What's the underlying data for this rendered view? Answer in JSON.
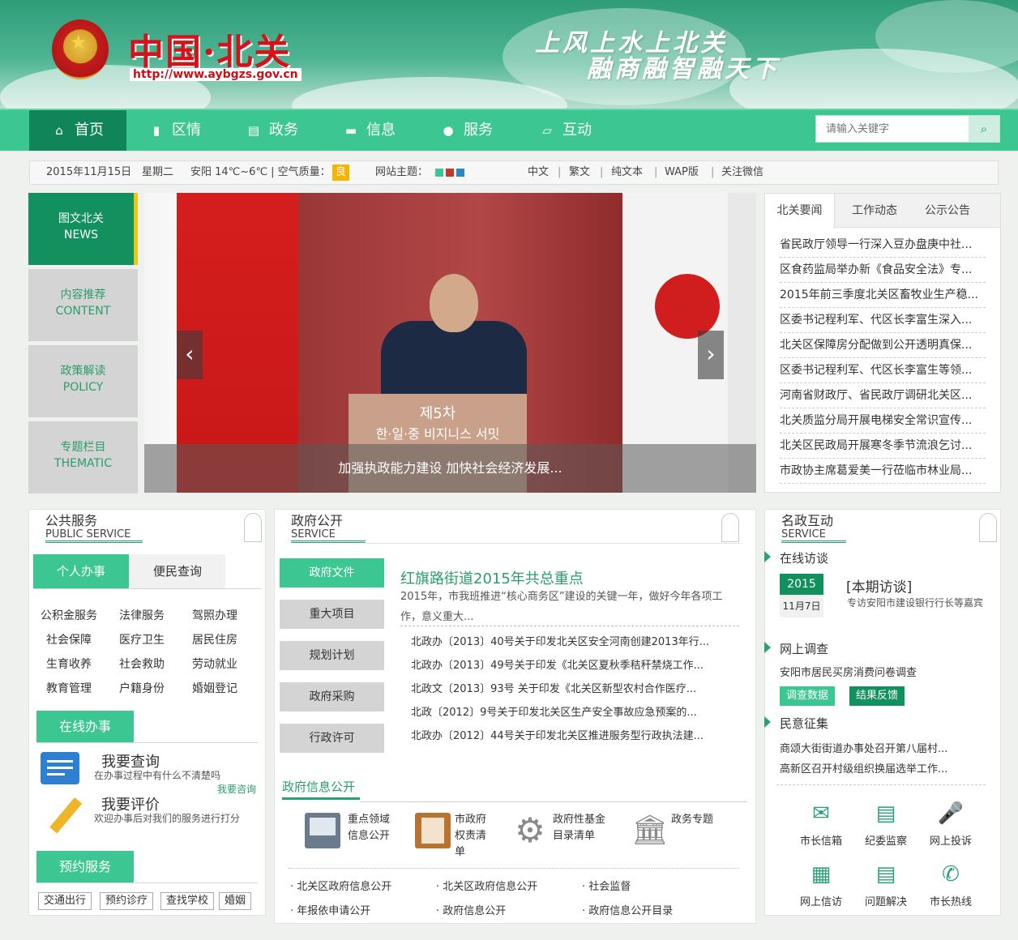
{
  "header": {
    "site_name": "中国·北关",
    "url": "http://www.aybgzs.gov.cn",
    "slogan_line1": "上风上水上北关",
    "slogan_line2": "融商融智融天下"
  },
  "nav": {
    "items": [
      {
        "label": "首页",
        "icon": "home-icon"
      },
      {
        "label": "区情",
        "icon": "bookmark-icon"
      },
      {
        "label": "政务",
        "icon": "list-icon"
      },
      {
        "label": "信息",
        "icon": "folder-icon"
      },
      {
        "label": "服务",
        "icon": "users-icon"
      },
      {
        "label": "互动",
        "icon": "folder-open-icon"
      }
    ],
    "search_placeholder": "请输入关键字"
  },
  "infobar": {
    "date": "2015年11月15日",
    "weekday": "星期二",
    "weather": "安阳  14℃~6℃ | 空气质量：",
    "air_quality": "良",
    "theme_label": "网站主题：",
    "theme_colors": [
      "#3cc792",
      "#c0392b",
      "#2e86c1"
    ],
    "links": [
      "中文",
      "|",
      "繁文",
      "|",
      "纯文本",
      "|",
      "WAP版",
      "|",
      "关注微信"
    ]
  },
  "side_tabs": [
    {
      "cn": "图文北关",
      "en": "NEWS"
    },
    {
      "cn": "内容推荐",
      "en": "CONTENT"
    },
    {
      "cn": "政策解读",
      "en": "POLICY"
    },
    {
      "cn": "专题栏目",
      "en": "THEMATIC"
    }
  ],
  "slider": {
    "podium_text": "제5차",
    "podium_text2": "한·일·중 비지니스 서밋",
    "caption": "加强执政能力建设 加快社会经济发展..."
  },
  "news": {
    "tabs": [
      "北关要闻",
      "工作动态",
      "公示公告"
    ],
    "items": [
      "省民政厅领导一行深入豆办盘庚中社...",
      "区食药监局举办新《食品安全法》专...",
      "2015年前三季度北关区畜牧业生产稳...",
      "区委书记程利军、代区长李富生深入...",
      "北关区保障房分配做到公开透明真保...",
      "区委书记程利军、代区长李富生等领...",
      "河南省财政厅、省民政厅调研北关区...",
      "北关质监分局开展电梯安全常识宣传...",
      "北关区民政局开展寒冬季节流浪乞讨...",
      "市政协主席葛爱美一行莅临市林业局..."
    ]
  },
  "public_service": {
    "title": "公共服务",
    "subtitle": "PUBLIC SERVICE",
    "tabs": [
      "个人办事",
      "便民查询"
    ],
    "services": [
      [
        "公积金服务",
        "法律服务",
        "驾照办理"
      ],
      [
        "社会保障",
        "医疗卫生",
        "居民住房"
      ],
      [
        "生育收养",
        "社会救助",
        "劳动就业"
      ],
      [
        "教育管理",
        "户籍身份",
        "婚姻登记"
      ]
    ],
    "online": "在线办事",
    "query_title": "我要查询",
    "query_desc": "在办事过程中有什么不清楚吗",
    "query_link": "我要咨询",
    "eval_title": "我要评价",
    "eval_desc": "欢迎办事后对我们的服务进行打分",
    "booking": "预约服务",
    "booking_items": [
      "交通出行",
      "预约诊疗",
      "查找学校",
      "婚姻"
    ]
  },
  "gov": {
    "title": "政府公开",
    "subtitle": "SERVICE",
    "tabs": [
      "政府文件",
      "重大项目",
      "规划计划",
      "政府采购",
      "行政许可"
    ],
    "headline": "红旗路街道2015年共总重点",
    "summary": "2015年，市我班推进“核心商务区”建设的关键一年，做好今年各项工作，意义重大...",
    "docs": [
      "北政办〔2013〕40号关于印发北关区安全河南创建2013年行...",
      "北政办〔2013〕49号关于印发《北关区夏秋季秸秆禁烧工作...",
      "北政文〔2013〕93号 关于印发《北关区新型农村合作医疗...",
      "北政〔2012〕9号关于印发北关区生产安全事故应急预案的...",
      "北政办〔2012〕44号关于印发北关区推进服务型行政执法建..."
    ],
    "info_title": "政府信息公开",
    "info_items": [
      {
        "l1": "重点领域",
        "l2": "信息公开",
        "l3": ""
      },
      {
        "l1": "市政府",
        "l2": "权责清",
        "l3": "单"
      },
      {
        "l1": "政府性基金",
        "l2": "目录清单",
        "l3": ""
      },
      {
        "l1": "政务专题",
        "l2": "",
        "l3": ""
      }
    ],
    "links": [
      "北关区政府信息公开",
      "北关区政府信息公开",
      "社会监督",
      "年报依申请公开",
      "政府信息公开",
      "政府信息公开目录"
    ]
  },
  "interact": {
    "title": "名政互动",
    "subtitle": "SERVICE",
    "interview": "在线访谈",
    "year": "2015",
    "date": "11月7日",
    "issue": "[本期访谈]",
    "issue_desc": "专访安阳市建设银行行长等嘉宾",
    "survey": "网上调查",
    "survey_item": "安阳市居民买房消费问卷调查",
    "survey_btn1": "调查数据",
    "survey_btn2": "结果反馈",
    "opinion": "民意征集",
    "opinion_items": [
      "商颂大街街道办事处召开第八届村...",
      "高新区召开村级组织换届选举工作..."
    ],
    "buttons": [
      {
        "label": "市长信箱",
        "icon": "mail-icon"
      },
      {
        "label": "纪委监察",
        "icon": "document-icon"
      },
      {
        "label": "网上投诉",
        "icon": "microphone-icon"
      },
      {
        "label": "网上信访",
        "icon": "calendar-icon"
      },
      {
        "label": "问题解决",
        "icon": "document-icon"
      },
      {
        "label": "市长热线",
        "icon": "phone-icon"
      }
    ]
  }
}
